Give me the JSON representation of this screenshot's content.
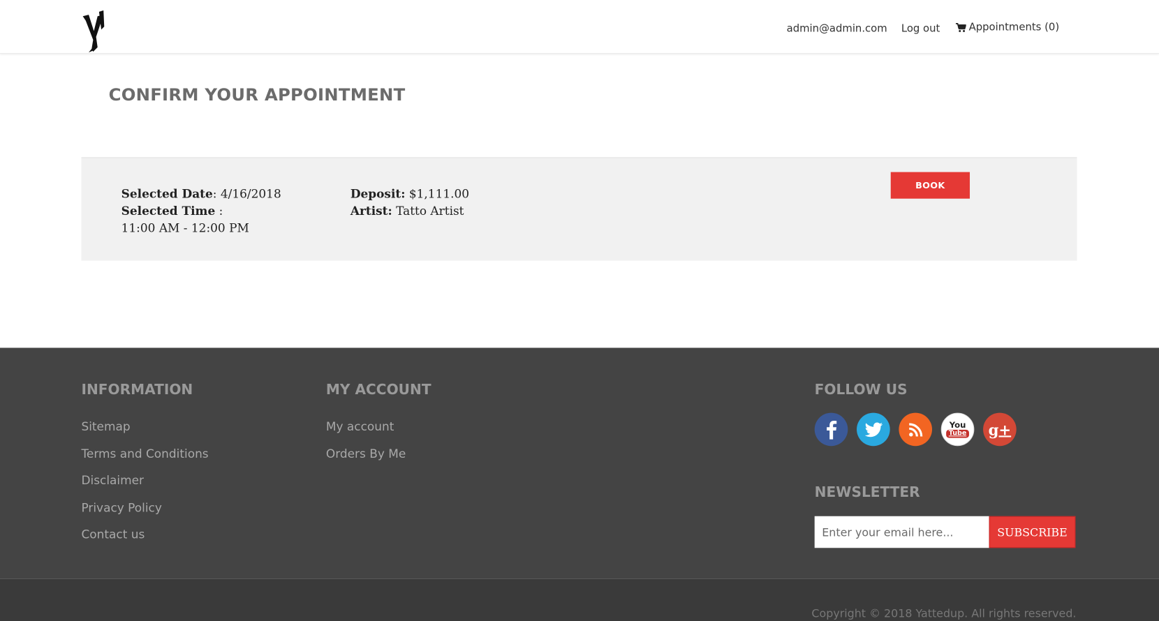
{
  "header": {
    "logo_alt": "Yattedup",
    "user_email": "admin@admin.com",
    "logout_label": "Log out",
    "appointments_label": "Appointments (0)"
  },
  "main": {
    "title": "CONFIRM YOUR APPOINTMENT",
    "appointment": {
      "date_label": "Selected Date",
      "date_value": ": 4/16/2018",
      "time_label": "Selected Time",
      "time_sep": " :",
      "time_value": "11:00 AM - 12:00 PM",
      "deposit_label": "Deposit:",
      "deposit_value": " $1,111.00",
      "artist_label": "Artist:",
      "artist_value": " Tatto Artist"
    },
    "book_label": "BOOK"
  },
  "footer": {
    "information": {
      "heading": "INFORMATION",
      "links": [
        "Sitemap",
        "Terms and Conditions",
        "Disclaimer",
        "Privacy Policy",
        "Contact us"
      ]
    },
    "account": {
      "heading": "MY ACCOUNT",
      "links": [
        "My account",
        "Orders By Me"
      ]
    },
    "follow": {
      "heading": "FOLLOW US",
      "icons": [
        "facebook-icon",
        "twitter-icon",
        "rss-icon",
        "youtube-icon",
        "google-plus-icon"
      ],
      "youtube_text": "You Tube",
      "gplus_text": "g+"
    },
    "newsletter": {
      "heading": "NEWSLETTER",
      "placeholder": "Enter your email here...",
      "subscribe_label": "SUBSCRIBE"
    },
    "copyright": "Copyright © 2018 Yattedup. All rights reserved."
  },
  "colors": {
    "accent": "#e53935",
    "footer_bg": "#444444",
    "facebook": "#3b5998",
    "twitter": "#2aa9e0",
    "rss": "#f26522",
    "youtube_bg": "#ffffff",
    "gplus": "#d34836"
  }
}
